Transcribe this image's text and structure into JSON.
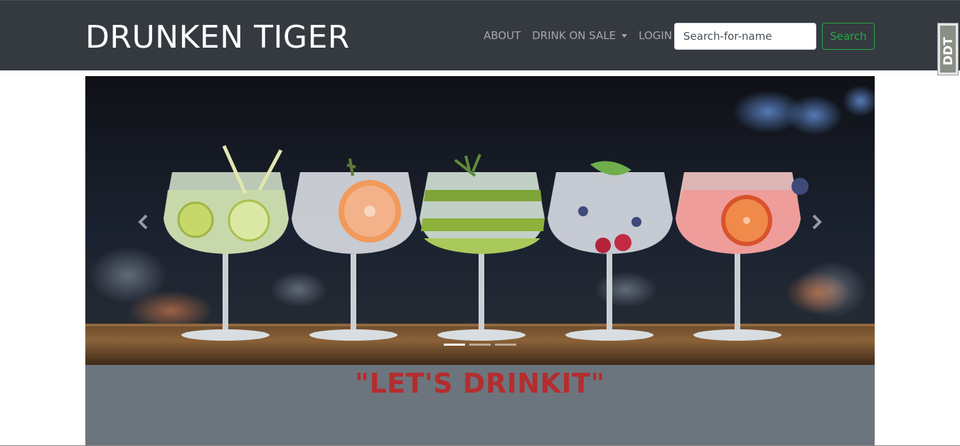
{
  "navbar": {
    "brand": "DRUNKEN TIGER",
    "links": [
      {
        "label": "ABOUT"
      },
      {
        "label": "DRINK ON SALE"
      },
      {
        "label": "LOGIN"
      }
    ],
    "search": {
      "placeholder": "Search-for-name",
      "button_label": "Search"
    },
    "bg_color": "#343a40",
    "search_button_color": "#28a745"
  },
  "extension_badge": {
    "text": "DDT"
  },
  "carousel": {
    "prev_icon": "chevron-left-icon",
    "next_icon": "chevron-right-icon",
    "slides_count": 3,
    "active_index": 0
  },
  "tagline": {
    "text": "\"LET'S DRINKIT\"",
    "color": "#b32d2e",
    "band_color": "#6c757d"
  }
}
